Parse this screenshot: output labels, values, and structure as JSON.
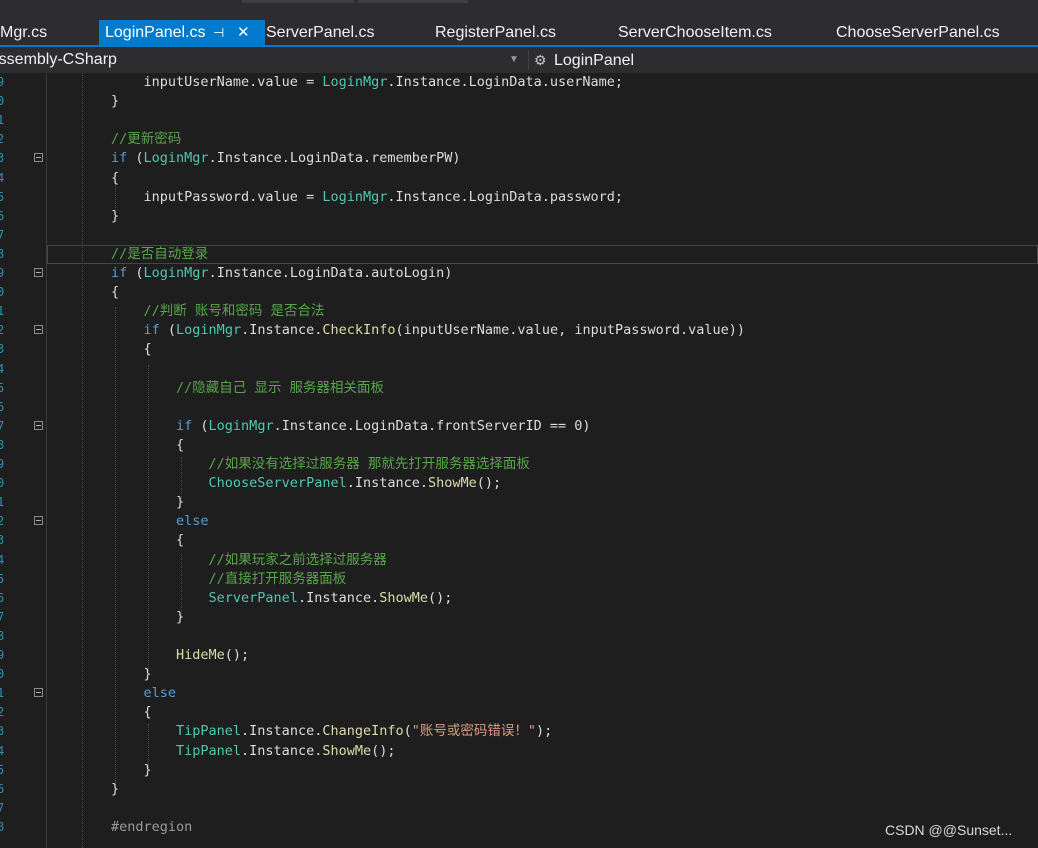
{
  "tabs": [
    {
      "label": "Mgr.cs",
      "active": false
    },
    {
      "label": "LoginPanel.cs",
      "active": true,
      "pin_icon": "pin-icon",
      "close_icon": "close-icon"
    },
    {
      "label": "ServerPanel.cs",
      "active": false
    },
    {
      "label": "RegisterPanel.cs",
      "active": false
    },
    {
      "label": "ServerChooseItem.cs",
      "active": false
    },
    {
      "label": "ChooseServerPanel.cs",
      "active": false
    }
  ],
  "navbar": {
    "project": "Assembly-CSharp",
    "class_icon": "class-icon",
    "class_name": "LoginPanel"
  },
  "line_numbers": [
    "9",
    "0",
    "1",
    "2",
    "3",
    "4",
    "5",
    "6",
    "7",
    "8",
    "9",
    "0",
    "1",
    "2",
    "3",
    "4",
    "5",
    "6",
    "7",
    "8",
    "9",
    "0",
    "1",
    "2",
    "3",
    "4",
    "5",
    "6",
    "7",
    "8",
    "9",
    "0",
    "1",
    "2",
    "3",
    "4",
    "5",
    "6",
    "7",
    "8"
  ],
  "code_lines": [
    [
      {
        "c": "pl",
        "t": "    inputUserName.value = "
      },
      {
        "c": "ty",
        "t": "LoginMgr"
      },
      {
        "c": "pl",
        "t": ".Instance.LoginData.userName;"
      }
    ],
    [
      {
        "c": "pl",
        "t": "}"
      }
    ],
    [],
    [
      {
        "c": "cm",
        "t": "//更新密码"
      }
    ],
    [
      {
        "c": "kw",
        "t": "if"
      },
      {
        "c": "pl",
        "t": " ("
      },
      {
        "c": "ty",
        "t": "LoginMgr"
      },
      {
        "c": "pl",
        "t": ".Instance.LoginData.rememberPW)"
      }
    ],
    [
      {
        "c": "pl",
        "t": "{"
      }
    ],
    [
      {
        "c": "pl",
        "t": "    inputPassword.value = "
      },
      {
        "c": "ty",
        "t": "LoginMgr"
      },
      {
        "c": "pl",
        "t": ".Instance.LoginData.password;"
      }
    ],
    [
      {
        "c": "pl",
        "t": "}"
      }
    ],
    [],
    [
      {
        "c": "cm",
        "t": "//是否自动登录"
      }
    ],
    [
      {
        "c": "kw",
        "t": "if"
      },
      {
        "c": "pl",
        "t": " ("
      },
      {
        "c": "ty",
        "t": "LoginMgr"
      },
      {
        "c": "pl",
        "t": ".Instance.LoginData.autoLogin)"
      }
    ],
    [
      {
        "c": "pl",
        "t": "{"
      }
    ],
    [
      {
        "c": "cm",
        "t": "    //判断 账号和密码 是否合法"
      }
    ],
    [
      {
        "c": "kw",
        "t": "    if"
      },
      {
        "c": "pl",
        "t": " ("
      },
      {
        "c": "ty",
        "t": "LoginMgr"
      },
      {
        "c": "pl",
        "t": ".Instance."
      },
      {
        "c": "me",
        "t": "CheckInfo"
      },
      {
        "c": "pl",
        "t": "(inputUserName.value, inputPassword.value))"
      }
    ],
    [
      {
        "c": "pl",
        "t": "    {"
      }
    ],
    [],
    [
      {
        "c": "cm",
        "t": "        //隐藏自己 显示 服务器相关面板"
      }
    ],
    [],
    [
      {
        "c": "kw",
        "t": "        if"
      },
      {
        "c": "pl",
        "t": " ("
      },
      {
        "c": "ty",
        "t": "LoginMgr"
      },
      {
        "c": "pl",
        "t": ".Instance.LoginData.frontServerID == 0)"
      }
    ],
    [
      {
        "c": "pl",
        "t": "        {"
      }
    ],
    [
      {
        "c": "cm",
        "t": "            //如果没有选择过服务器 那就先打开服务器选择面板"
      }
    ],
    [
      {
        "c": "ty",
        "t": "            ChooseServerPanel"
      },
      {
        "c": "pl",
        "t": ".Instance."
      },
      {
        "c": "me",
        "t": "ShowMe"
      },
      {
        "c": "pl",
        "t": "();"
      }
    ],
    [
      {
        "c": "pl",
        "t": "        }"
      }
    ],
    [
      {
        "c": "kw",
        "t": "        else"
      }
    ],
    [
      {
        "c": "pl",
        "t": "        {"
      }
    ],
    [
      {
        "c": "cm",
        "t": "            //如果玩家之前选择过服务器"
      }
    ],
    [
      {
        "c": "cm",
        "t": "            //直接打开服务器面板"
      }
    ],
    [
      {
        "c": "ty",
        "t": "            ServerPanel"
      },
      {
        "c": "pl",
        "t": ".Instance."
      },
      {
        "c": "me",
        "t": "ShowMe"
      },
      {
        "c": "pl",
        "t": "();"
      }
    ],
    [
      {
        "c": "pl",
        "t": "        }"
      }
    ],
    [],
    [
      {
        "c": "me",
        "t": "        HideMe"
      },
      {
        "c": "pl",
        "t": "();"
      }
    ],
    [
      {
        "c": "pl",
        "t": "    }"
      }
    ],
    [
      {
        "c": "kw",
        "t": "    else"
      }
    ],
    [
      {
        "c": "pl",
        "t": "    {"
      }
    ],
    [
      {
        "c": "ty",
        "t": "        TipPanel"
      },
      {
        "c": "pl",
        "t": ".Instance."
      },
      {
        "c": "me",
        "t": "ChangeInfo"
      },
      {
        "c": "pl",
        "t": "("
      },
      {
        "c": "st",
        "t": "\"账号或密码错误！\""
      },
      {
        "c": "pl",
        "t": ");"
      }
    ],
    [
      {
        "c": "ty",
        "t": "        TipPanel"
      },
      {
        "c": "pl",
        "t": ".Instance."
      },
      {
        "c": "me",
        "t": "ShowMe"
      },
      {
        "c": "pl",
        "t": "();"
      }
    ],
    [
      {
        "c": "pl",
        "t": "    }"
      }
    ],
    [
      {
        "c": "pl",
        "t": "}"
      }
    ],
    [],
    [
      {
        "c": "pp",
        "t": "#endregion"
      }
    ]
  ],
  "watermark": "CSDN @@Sunset..."
}
